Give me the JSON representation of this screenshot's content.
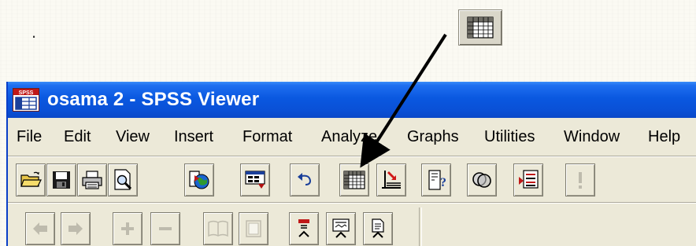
{
  "slide": {
    "bullet": "."
  },
  "window": {
    "title": "osama 2 - SPSS Viewer",
    "app_icon_text": "SPSS"
  },
  "menu": {
    "items": [
      "File",
      "Edit",
      "View",
      "Insert",
      "Format",
      "Analyze",
      "Graphs",
      "Utilities",
      "Window",
      "Help"
    ]
  },
  "toolbar": {
    "row1": [
      "open-icon",
      "save-icon",
      "print-icon",
      "print-preview-icon",
      "export-icon",
      "dialog-recall-icon",
      "undo-icon",
      "pivot-table-icon",
      "go-to-case-icon",
      "variables-icon",
      "use-sets-icon",
      "designate-window-icon",
      "run-script-icon"
    ],
    "row2": [
      "promote-icon",
      "demote-icon",
      "expand-icon",
      "collapse-icon",
      "show-icon",
      "hide-icon",
      "insert-heading-icon",
      "insert-title-icon",
      "insert-text-icon"
    ]
  },
  "colors": {
    "titlebar": "#0a58e0",
    "chrome": "#ece9d8",
    "arrow": "#000000"
  }
}
